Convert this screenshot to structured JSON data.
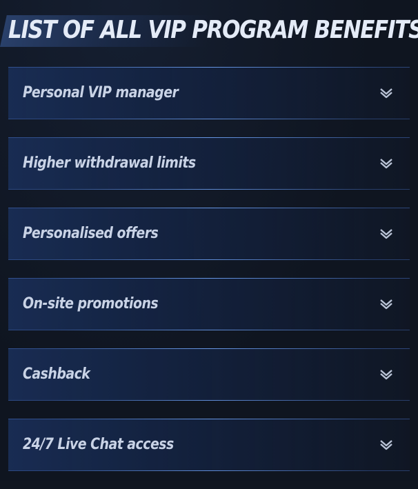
{
  "page": {
    "title": "LIST OF ALL VIP PROGRAM BENEFITS"
  },
  "benefits": {
    "items": [
      {
        "label": "Personal VIP manager",
        "icon": "chevron-down-icon"
      },
      {
        "label": "Higher withdrawal limits",
        "icon": "chevron-down-icon"
      },
      {
        "label": "Personalised offers",
        "icon": "chevron-down-icon"
      },
      {
        "label": "On-site promotions",
        "icon": "chevron-down-icon"
      },
      {
        "label": "Cashback",
        "icon": "chevron-down-icon"
      },
      {
        "label": "24/7 Live Chat access",
        "icon": "chevron-down-icon"
      }
    ]
  },
  "colors": {
    "background": "#0f1520",
    "title_text": "#e4ebf7",
    "item_text": "#c9d3e6",
    "accent_line": "#6ea0f0",
    "chevron": "#b9c3d6"
  }
}
